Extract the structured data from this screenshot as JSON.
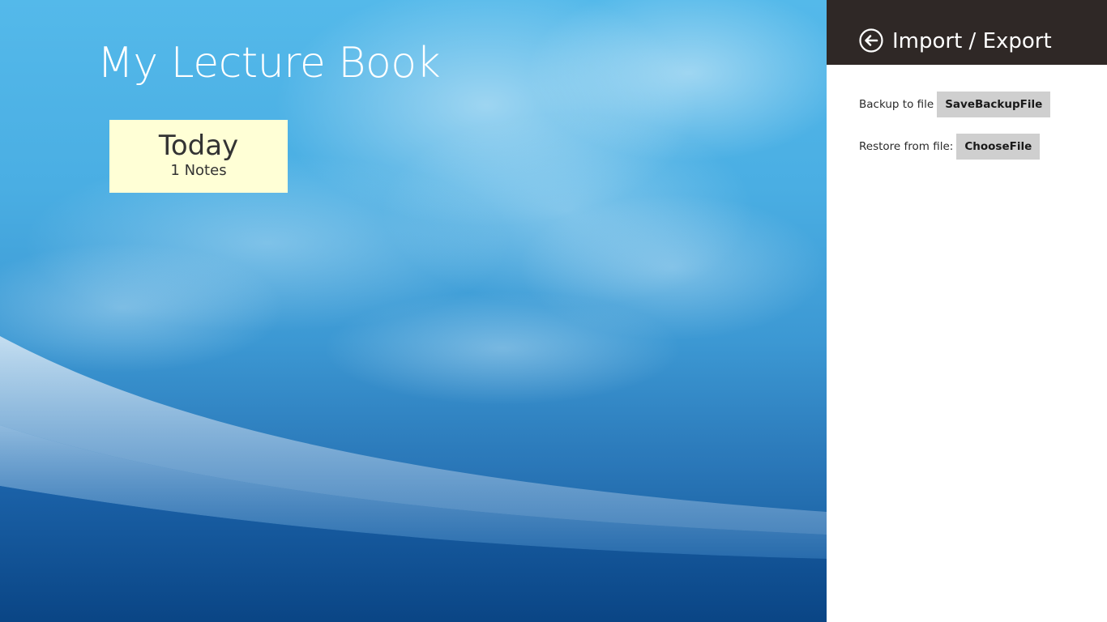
{
  "app": {
    "title": "My Lecture Book"
  },
  "tiles": [
    {
      "title": "Today",
      "count": "1 Notes"
    }
  ],
  "flyout": {
    "title": "Import / Export",
    "back_icon": "back-arrow-circle-icon",
    "backup": {
      "label": "Backup to file",
      "button": "SaveBackupFile"
    },
    "restore": {
      "label": "Restore from file:",
      "button": "ChooseFile"
    }
  },
  "colors": {
    "flyout_header": "#2f2826",
    "tile_background": "#ffffd6",
    "button_background": "#cfcfcf",
    "sky_top": "#54b9ea",
    "sky_bottom": "#0d4f92"
  }
}
